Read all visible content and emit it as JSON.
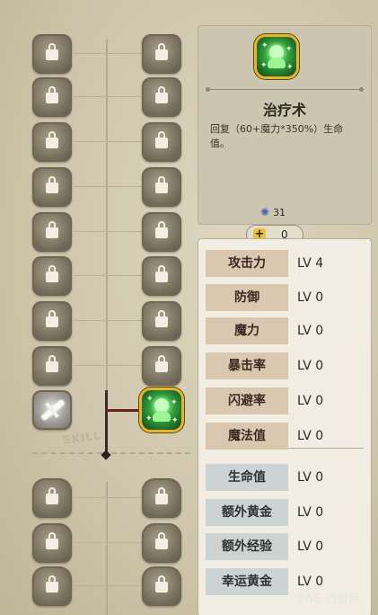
{
  "skill_tree": {
    "separator_label": "SKILL",
    "left_column": [
      {
        "icon": "locked-skill-icon",
        "state": "locked"
      },
      {
        "icon": "locked-skill-icon",
        "state": "locked"
      },
      {
        "icon": "locked-skill-icon",
        "state": "locked"
      },
      {
        "icon": "locked-skill-icon",
        "state": "locked"
      },
      {
        "icon": "locked-skill-icon",
        "state": "locked"
      },
      {
        "icon": "locked-skill-icon",
        "state": "locked"
      },
      {
        "icon": "locked-skill-icon",
        "state": "locked"
      },
      {
        "icon": "locked-skill-icon",
        "state": "locked"
      },
      {
        "icon": "sword-skill-icon",
        "state": "unlocked"
      },
      {
        "icon": "locked-passive-icon",
        "state": "locked"
      },
      {
        "icon": "locked-passive-icon",
        "state": "locked"
      },
      {
        "icon": "locked-passive-icon",
        "state": "locked"
      }
    ],
    "right_column": [
      {
        "icon": "locked-skill-icon",
        "state": "locked"
      },
      {
        "icon": "locked-skill-icon",
        "state": "locked"
      },
      {
        "icon": "locked-skill-icon",
        "state": "locked"
      },
      {
        "icon": "locked-skill-icon",
        "state": "locked"
      },
      {
        "icon": "locked-skill-icon",
        "state": "locked"
      },
      {
        "icon": "locked-skill-icon",
        "state": "locked"
      },
      {
        "icon": "locked-skill-icon",
        "state": "locked"
      },
      {
        "icon": "locked-skill-icon",
        "state": "locked"
      },
      {
        "icon": "heal-skill-icon",
        "state": "selected"
      },
      {
        "icon": "locked-passive-icon",
        "state": "locked"
      },
      {
        "icon": "locked-passive-icon",
        "state": "locked"
      },
      {
        "icon": "locked-passive-icon",
        "state": "locked"
      }
    ]
  },
  "detail": {
    "icon": "heal-skill-icon",
    "name": "治疗术",
    "description": "回复（60+魔力*350%）生命值。",
    "cost_icon": "gem-icon",
    "cost": "31"
  },
  "points": {
    "icon": "plus-icon",
    "value": "0"
  },
  "stats": [
    {
      "label": "攻击力",
      "value": "LV 4",
      "group": "attack"
    },
    {
      "label": "防御",
      "value": "LV 0",
      "group": "attack"
    },
    {
      "label": "魔力",
      "value": "LV 0",
      "group": "attack"
    },
    {
      "label": "暴击率",
      "value": "LV 0",
      "group": "attack"
    },
    {
      "label": "闪避率",
      "value": "LV 0",
      "group": "attack"
    },
    {
      "label": "魔法值",
      "value": "LV 0",
      "group": "attack"
    },
    {
      "label": "生命值",
      "value": "LV 0",
      "group": "bonus"
    },
    {
      "label": "额外黄金",
      "value": "LV 0",
      "group": "bonus"
    },
    {
      "label": "额外经验",
      "value": "LV 0",
      "group": "bonus"
    },
    {
      "label": "幸运黄金",
      "value": "LV 0",
      "group": "bonus"
    }
  ],
  "watermark": "9AE 当游网"
}
